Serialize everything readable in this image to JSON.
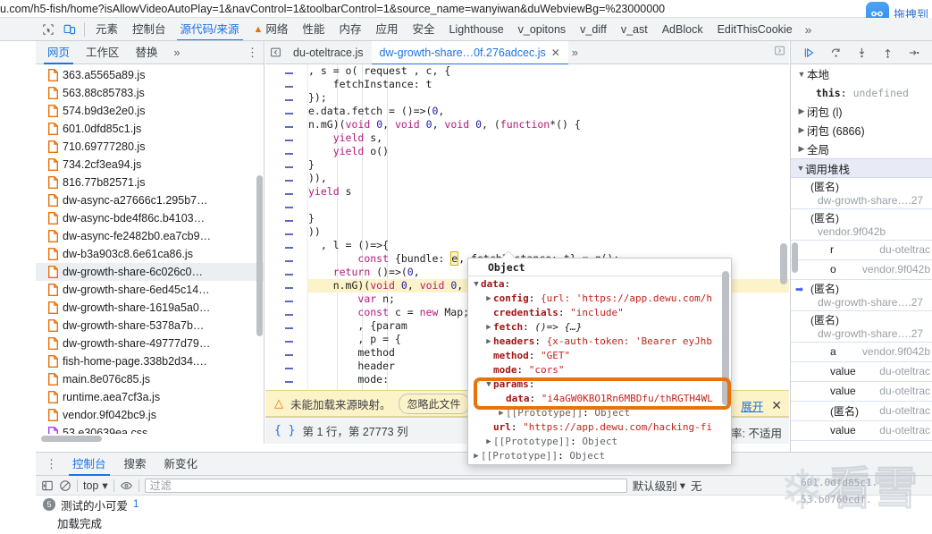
{
  "browser": {
    "url": "u.com/h5-fish/home?isAllowVideoAutoPlay=1&navControl=1&toolbarControl=1&source_name=wanyiwan&duWebviewBg=%23000000",
    "extension_label": "拖拽到"
  },
  "devtools": {
    "tabs": [
      {
        "label": "元素",
        "active": false
      },
      {
        "label": "控制台",
        "active": false
      },
      {
        "label": "源代码/来源",
        "active": true
      },
      {
        "label": "网络",
        "active": false,
        "warn": true
      },
      {
        "label": "性能",
        "active": false
      },
      {
        "label": "内存",
        "active": false
      },
      {
        "label": "应用",
        "active": false
      },
      {
        "label": "安全",
        "active": false
      },
      {
        "label": "Lighthouse",
        "active": false
      },
      {
        "label": "v_opitons",
        "active": false
      },
      {
        "label": "v_diff",
        "active": false
      },
      {
        "label": "v_ast",
        "active": false
      },
      {
        "label": "AdBlock",
        "active": false
      },
      {
        "label": "EditThisCookie",
        "active": false
      }
    ],
    "overflow_label": "»"
  },
  "navigator": {
    "tabs": [
      {
        "label": "网页",
        "active": true
      },
      {
        "label": "工作区",
        "active": false
      },
      {
        "label": "替换",
        "active": false
      }
    ],
    "overflow_label": "»",
    "files": [
      {
        "name": "363.a5565a89.js",
        "type": "js",
        "selected": false
      },
      {
        "name": "563.88c85783.js",
        "type": "js",
        "selected": false
      },
      {
        "name": "574.b9d3e2e0.js",
        "type": "js",
        "selected": false
      },
      {
        "name": "601.0dfd85c1.js",
        "type": "js",
        "selected": false
      },
      {
        "name": "710.69777280.js",
        "type": "js",
        "selected": false
      },
      {
        "name": "734.2cf3ea94.js",
        "type": "js",
        "selected": false
      },
      {
        "name": "816.77b82571.js",
        "type": "js",
        "selected": false
      },
      {
        "name": "dw-async-a27666c1.295b7…",
        "type": "js",
        "selected": false
      },
      {
        "name": "dw-async-bde4f86c.b4103…",
        "type": "js",
        "selected": false
      },
      {
        "name": "dw-async-fe2482b0.ea7cb9…",
        "type": "js",
        "selected": false
      },
      {
        "name": "dw-b3a903c8.6e61ca86.js",
        "type": "js",
        "selected": false
      },
      {
        "name": "dw-growth-share-6c026c0…",
        "type": "js",
        "selected": true
      },
      {
        "name": "dw-growth-share-6ed45c14…",
        "type": "js",
        "selected": false
      },
      {
        "name": "dw-growth-share-1619a5a0…",
        "type": "js",
        "selected": false
      },
      {
        "name": "dw-growth-share-5378a7b…",
        "type": "js",
        "selected": false
      },
      {
        "name": "dw-growth-share-49777d79…",
        "type": "js",
        "selected": false
      },
      {
        "name": "fish-home-page.338b2d34.…",
        "type": "js",
        "selected": false
      },
      {
        "name": "main.8e076c85.js",
        "type": "js",
        "selected": false
      },
      {
        "name": "runtime.aea7cf3a.js",
        "type": "js",
        "selected": false
      },
      {
        "name": "vendor.9f042bc9.js",
        "type": "js",
        "selected": false
      },
      {
        "name": "53.e30639ea.css",
        "type": "css",
        "selected": false
      }
    ]
  },
  "editor": {
    "tabs": [
      {
        "label": "du-oteltrace.js",
        "active": false,
        "closable": false
      },
      {
        "label": "dw-growth-share…0f.276adcec.js",
        "active": true,
        "closable": true
      }
    ],
    "overflow_label": "»",
    "code_lines": [
      ", s = o( request , c, {",
      "    fetchInstance: t",
      "});",
      "e.data.fetch = ()=>(0,",
      "n.mG)(void 0, void 0, void 0, (function*() {",
      "    yield s,",
      "    yield o()",
      "}",
      ")),",
      "yield s",
      "",
      "}",
      "))",
      "  , l = ()=>{",
      "    const {bundle: e, fetchInstance: t} = g();",
      "    return ()=>(0,",
      "    n.mG)(void 0, void 0, void 0, (functio",
      "        var n;",
      "        const c = new Map;",
      "        , {param                        credenti",
      "        , p = {",
      "        method",
      "        header",
      "        mode:"
    ],
    "selected_token": "e",
    "source_map_warning": "未能加载来源映射。",
    "ignore_file_button": "忽略此文件",
    "expand_link": "展开",
    "close_label": "✕",
    "position_status": "第 1 行，第 27773 列",
    "coverage_status": "率: 不适用"
  },
  "popover": {
    "title": "Object",
    "rows": [
      {
        "indent": 0,
        "twisty": "▼",
        "name": "data",
        "sep": ":",
        "value": "",
        "vstyle": "none",
        "highlight": false
      },
      {
        "indent": 1,
        "twisty": "▶",
        "name": "config",
        "sep": ":",
        "value": "{url: 'https://app.dewu.com/h",
        "vstyle": "mixed",
        "highlight": false
      },
      {
        "indent": 1,
        "twisty": "",
        "name": "credentials",
        "sep": ":",
        "value": "\"include\"",
        "vstyle": "str",
        "highlight": false
      },
      {
        "indent": 1,
        "twisty": "▶",
        "name": "fetch",
        "sep": ":",
        "value": "()=> {…}",
        "vstyle": "fn",
        "highlight": false
      },
      {
        "indent": 1,
        "twisty": "▶",
        "name": "headers",
        "sep": ":",
        "value": "{x-auth-token: 'Bearer eyJhb",
        "vstyle": "mixed",
        "highlight": false
      },
      {
        "indent": 1,
        "twisty": "",
        "name": "method",
        "sep": ":",
        "value": "\"GET\"",
        "vstyle": "str",
        "highlight": false
      },
      {
        "indent": 1,
        "twisty": "",
        "name": "mode",
        "sep": ":",
        "value": "\"cors\"",
        "vstyle": "str",
        "highlight": false
      },
      {
        "indent": 1,
        "twisty": "▼",
        "name": "params",
        "sep": ":",
        "value": "",
        "vstyle": "none",
        "highlight": true
      },
      {
        "indent": 2,
        "twisty": "",
        "name": "data",
        "sep": ":",
        "value": "\"i4aGW0KBO1Rn6MBDfu/thRGTH4WL",
        "vstyle": "str",
        "highlight": true
      },
      {
        "indent": 2,
        "twisty": "▶",
        "name": "[[Prototype]]",
        "sep": ":",
        "value": "Object",
        "vstyle": "dim",
        "highlight": false
      },
      {
        "indent": 1,
        "twisty": "",
        "name": "url",
        "sep": ":",
        "value": "\"https://app.dewu.com/hacking-fi",
        "vstyle": "str",
        "highlight": false
      },
      {
        "indent": 1,
        "twisty": "▶",
        "name": "[[Prototype]]",
        "sep": ":",
        "value": "Object",
        "vstyle": "dim",
        "highlight": false
      },
      {
        "indent": 0,
        "twisty": "▶",
        "name": "[[Prototype]]",
        "sep": ":",
        "value": "Object",
        "vstyle": "dim",
        "highlight": false
      }
    ]
  },
  "debugger": {
    "controls": [
      {
        "icon": "resume-icon",
        "name": "resume-script-execution"
      },
      {
        "icon": "step-over-icon",
        "name": "step-over-next-function-call"
      },
      {
        "icon": "step-into-icon",
        "name": "step-into-next-function-call"
      },
      {
        "icon": "step-out-icon",
        "name": "step-out-of-current-function"
      },
      {
        "icon": "step-icon",
        "name": "step"
      }
    ],
    "scope_rows": [
      {
        "twisty": "▼",
        "label": "本地",
        "kind": "scope"
      },
      {
        "twisty": "",
        "label": "this",
        "value": "undefined",
        "kind": "prop"
      },
      {
        "twisty": "▶",
        "label": "闭包 (l)",
        "kind": "scope"
      },
      {
        "twisty": "▶",
        "label": "闭包 (6866)",
        "kind": "scope"
      },
      {
        "twisty": "▶",
        "label": "全局",
        "kind": "scope"
      }
    ],
    "callstack_header": "调用堆栈",
    "callstack": [
      {
        "fn": "(匿名)",
        "src": "dw-growth-share….27",
        "two_line": true,
        "current": false
      },
      {
        "fn": "(匿名)",
        "src": "vendor.9f042b",
        "two_line": true,
        "current": false
      },
      {
        "fn": "r",
        "src": "du-oteltrac",
        "two_line": false,
        "current": false
      },
      {
        "fn": "o",
        "src": "vendor.9f042b",
        "two_line": false,
        "current": false
      },
      {
        "fn": "(匿名)",
        "src": "dw-growth-share….27",
        "two_line": true,
        "current": true
      },
      {
        "fn": "(匿名)",
        "src": "dw-growth-share….27",
        "two_line": true,
        "current": false
      },
      {
        "fn": "a",
        "src": "vendor.9f042b",
        "two_line": false,
        "current": false
      },
      {
        "fn": "value",
        "src": "du-oteltrac",
        "two_line": false,
        "current": false
      },
      {
        "fn": "value",
        "src": "du-oteltrac",
        "two_line": false,
        "current": false
      },
      {
        "fn": "(匿名)",
        "src": "du-oteltrac",
        "two_line": false,
        "current": false
      },
      {
        "fn": "value",
        "src": "du-oteltrac",
        "two_line": false,
        "current": false
      }
    ]
  },
  "drawer": {
    "tabs": [
      {
        "label": "控制台",
        "active": true
      },
      {
        "label": "搜索",
        "active": false
      },
      {
        "label": "新变化",
        "active": false
      }
    ],
    "toolbar": {
      "sidebar_toggle": "console-sidebar-icon",
      "clear": "clear-console-icon",
      "context": "top",
      "eye": "live-expression-icon",
      "filter_placeholder": "过滤",
      "level": "默认级别",
      "issues": "无"
    },
    "messages": [
      {
        "count": "5",
        "text": "测试的小可爱",
        "source": "1"
      },
      {
        "count": "",
        "text": "加载完成",
        "source": ""
      }
    ],
    "source_refs": [
      "601.0dfd85c1.",
      "53.b0760cdf."
    ]
  },
  "watermark": {
    "glyph": "❄",
    "text": "看雪"
  },
  "colors": {
    "accent": "#1a73e8",
    "warn": "#e8710a",
    "highlight": "#e8730a",
    "code_string": "#c5221f",
    "code_keyword": "#a31515",
    "paused_line": "#fdf3c8"
  }
}
